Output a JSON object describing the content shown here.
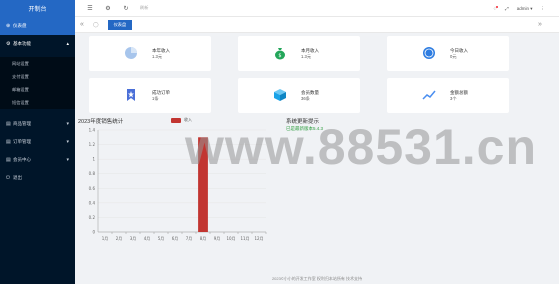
{
  "brand": "开制台",
  "sidebar": {
    "items": [
      {
        "label": "仪表盘",
        "active": true,
        "chevron": ""
      },
      {
        "label": "基本功能",
        "active": false,
        "chevron": "▴"
      },
      {
        "label": "商品管理",
        "active": false,
        "chevron": "▾"
      },
      {
        "label": "订单管理",
        "active": false,
        "chevron": "▾"
      },
      {
        "label": "会员中心",
        "active": false,
        "chevron": "▾"
      },
      {
        "label": "退出",
        "active": false,
        "chevron": ""
      }
    ],
    "subitems": [
      "网站设置",
      "支付设置",
      "邮箱设置",
      "短信设置"
    ]
  },
  "topbar": {
    "search_text": "刷新",
    "username": "admin",
    "user_chevron": "▾"
  },
  "tabs": [
    {
      "label": "仪表盘"
    }
  ],
  "cards": [
    {
      "label": "本年收入",
      "value": "1.3元",
      "icon": "pie-chart-icon",
      "color": "#a7c5ec"
    },
    {
      "label": "本月收入",
      "value": "1.3元",
      "icon": "money-bag-icon",
      "color": "#23a65a"
    },
    {
      "label": "今日收入",
      "value": "0元",
      "icon": "coin-icon",
      "color": "#2f7de1"
    },
    {
      "label": "成功订单",
      "value": "1条",
      "icon": "bookmark-icon",
      "color": "#4a6fd8"
    },
    {
      "label": "会员数量",
      "value": "36条",
      "icon": "cube-icon",
      "color": "#1aa3e8"
    },
    {
      "label": "金额总额",
      "value": "3个",
      "icon": "trend-icon",
      "color": "#4a8ef0"
    }
  ],
  "chart": {
    "title": "2023年度销售统计",
    "notice_title": "系统更新提示",
    "notice_item": "已是最新版本5.4.3",
    "footer": "2023©小小的开发工作室 权利归本站所有 技术支持",
    "watermark": "www.88531.cn"
  },
  "chart_data": {
    "type": "bar",
    "categories": [
      "1月",
      "2月",
      "3月",
      "4月",
      "5月",
      "6月",
      "7月",
      "8月",
      "9月",
      "10月",
      "11月",
      "12月"
    ],
    "series": [
      {
        "name": "收入",
        "values": [
          0,
          0,
          0,
          0,
          0,
          0,
          0,
          1.3,
          0,
          0,
          0,
          0
        ],
        "color": "#c23531"
      }
    ],
    "yticks": [
      "0",
      "0.2",
      "0.4",
      "0.6",
      "0.8",
      "1",
      "1.2",
      "1.4"
    ],
    "ylim": [
      0,
      1.4
    ]
  }
}
